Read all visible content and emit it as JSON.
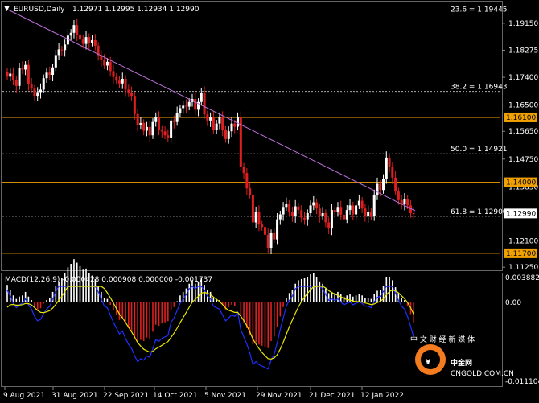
{
  "header": {
    "symbol_timeframe": "EURUSD,Daily",
    "ohlc": "1.12971 1.12995 1.12934 1.12990",
    "dropdown_glyph": "▼"
  },
  "macd": {
    "label": "MACD(12,26,9) -0.000428 0.000908 0.000000 -0.001737"
  },
  "watermark": {
    "logo_text": "中金网",
    "logo_glyph": "¥",
    "tagline": "中 文 财 经 新 媒 体",
    "domain": "CNGOLD.COM.CN"
  },
  "colors": {
    "background": "#000000",
    "bull": "#ffffff",
    "bear": "#e02020",
    "trendline": "#c070e0",
    "hline": "#f0a000",
    "fib": "#aaaaaa",
    "macd_line": "#2030ff",
    "signal_line": "#e8e800",
    "tag_bg": "#f0a000"
  },
  "chart_data": {
    "type": "candlestick",
    "symbol": "EURUSD",
    "timeframe": "Daily",
    "x_labels": [
      "9 Aug 2021",
      "31 Aug 2021",
      "22 Sep 2021",
      "14 Oct 2021",
      "5 Nov 2021",
      "29 Nov 2021",
      "21 Dec 2021",
      "12 Jan 2022"
    ],
    "y_ticks": [
      "1.19150",
      "1.18275",
      "1.17400",
      "1.16500",
      "1.15650",
      "1.14750",
      "1.13850",
      "1.12100",
      "1.11250"
    ],
    "ylim": [
      1.1115,
      1.1985
    ],
    "fib_levels": [
      {
        "label": "23.6 = 1.19445",
        "price": 1.19445
      },
      {
        "label": "38.2 = 1.16943",
        "price": 1.16943
      },
      {
        "label": "50.0 = 1.14921",
        "price": 1.14921
      },
      {
        "label": "61.8 = 1.12900",
        "price": 1.129
      }
    ],
    "horizontal_levels": [
      {
        "label": "1.16100",
        "price": 1.161
      },
      {
        "label": "1.14000",
        "price": 1.14
      },
      {
        "label": "1.11700",
        "price": 1.117
      }
    ],
    "current_price": {
      "label": "1.12990",
      "price": 1.1299
    },
    "trendline": {
      "from": {
        "date": "2021-09-03",
        "price": 1.1909
      },
      "to": {
        "date": "2022-01-20",
        "price": 1.1318
      }
    },
    "candles_closes": [
      1.1742,
      1.1752,
      1.1732,
      1.1712,
      1.1771,
      1.1765,
      1.178,
      1.1718,
      1.1703,
      1.168,
      1.1692,
      1.17,
      1.1737,
      1.1755,
      1.1748,
      1.1772,
      1.1812,
      1.183,
      1.1828,
      1.1846,
      1.1875,
      1.1884,
      1.1909,
      1.1878,
      1.1862,
      1.1848,
      1.187,
      1.1852,
      1.186,
      1.1842,
      1.1812,
      1.1795,
      1.1778,
      1.179,
      1.176,
      1.1741,
      1.1729,
      1.172,
      1.1735,
      1.17,
      1.169,
      1.168,
      1.1621,
      1.1585,
      1.1592,
      1.1567,
      1.1579,
      1.1552,
      1.1595,
      1.161,
      1.157,
      1.1565,
      1.1552,
      1.1545,
      1.16,
      1.1595,
      1.1625,
      1.164,
      1.1648,
      1.1645,
      1.166,
      1.167,
      1.1635,
      1.166,
      1.169,
      1.162,
      1.16,
      1.161,
      1.157,
      1.159,
      1.161,
      1.157,
      1.154,
      1.1565,
      1.159,
      1.158,
      1.161,
      1.145,
      1.143,
      1.138,
      1.136,
      1.127,
      1.1305,
      1.1263,
      1.1255,
      1.123,
      1.1188,
      1.1235,
      1.1215,
      1.128,
      1.1296,
      1.132,
      1.133,
      1.1305,
      1.129,
      1.1322,
      1.131,
      1.1285,
      1.128,
      1.13,
      1.1325,
      1.1335,
      1.1315,
      1.129,
      1.13,
      1.127,
      1.125,
      1.131,
      1.1305,
      1.132,
      1.1295,
      1.128,
      1.131,
      1.1325,
      1.1296,
      1.1325,
      1.134,
      1.1315,
      1.129,
      1.1305,
      1.129,
      1.136,
      1.1395,
      1.1375,
      1.141,
      1.148,
      1.145,
      1.1415,
      1.137,
      1.1342,
      1.133,
      1.1345,
      1.1325,
      1.13,
      1.1299
    ],
    "macd_histogram": [
      0.0015,
      0.0011,
      0.0006,
      0.0003,
      0.0005,
      0.0006,
      0.0009,
      0.0005,
      0.0002,
      -0.0003,
      -0.0006,
      -0.0005,
      -0.0001,
      0.0002,
      0.0004,
      0.0009,
      0.0014,
      0.0018,
      0.0021,
      0.0025,
      0.003,
      0.0033,
      0.0037,
      0.0034,
      0.0031,
      0.0028,
      0.0029,
      0.0025,
      0.0023,
      0.002,
      0.0014,
      0.0009,
      0.0004,
      0.0003,
      -0.0002,
      -0.0007,
      -0.0011,
      -0.0015,
      -0.0013,
      -0.0018,
      -0.0022,
      -0.0025,
      -0.003,
      -0.0034,
      -0.0032,
      -0.0033,
      -0.003,
      -0.0031,
      -0.0025,
      -0.0019,
      -0.002,
      -0.0018,
      -0.0017,
      -0.0016,
      -0.0007,
      -0.0004,
      0.0001,
      0.0006,
      0.0009,
      0.0012,
      0.0016,
      0.0019,
      0.0016,
      0.0018,
      0.0021,
      0.0015,
      0.0011,
      0.0009,
      0.0004,
      0.0003,
      0.0002,
      -0.0002,
      -0.0006,
      -0.0004,
      -0.0002,
      -0.0003,
      0.0,
      -0.0012,
      -0.0017,
      -0.0022,
      -0.0028,
      -0.0036,
      -0.0034,
      -0.0036,
      -0.0037,
      -0.0038,
      -0.0039,
      -0.0033,
      -0.0029,
      -0.0021,
      -0.0012,
      -0.0004,
      0.0004,
      0.0008,
      0.0011,
      0.0016,
      0.0019,
      0.002,
      0.0021,
      0.0022,
      0.0024,
      0.0025,
      0.0022,
      0.0018,
      0.0016,
      0.0012,
      0.0008,
      0.0009,
      0.0008,
      0.0009,
      0.0007,
      0.0005,
      0.0006,
      0.0007,
      0.0005,
      0.0006,
      0.0007,
      0.0006,
      0.0004,
      0.0004,
      0.0003,
      0.0007,
      0.001,
      0.0011,
      0.0014,
      0.0022,
      0.0022,
      0.0019,
      0.0013,
      0.0008,
      0.0004,
      0.0002,
      -0.0003,
      -0.001,
      -0.0017
    ],
    "macd_y_ticks": [
      "0.003882",
      "0.00",
      "-0.011104"
    ]
  }
}
